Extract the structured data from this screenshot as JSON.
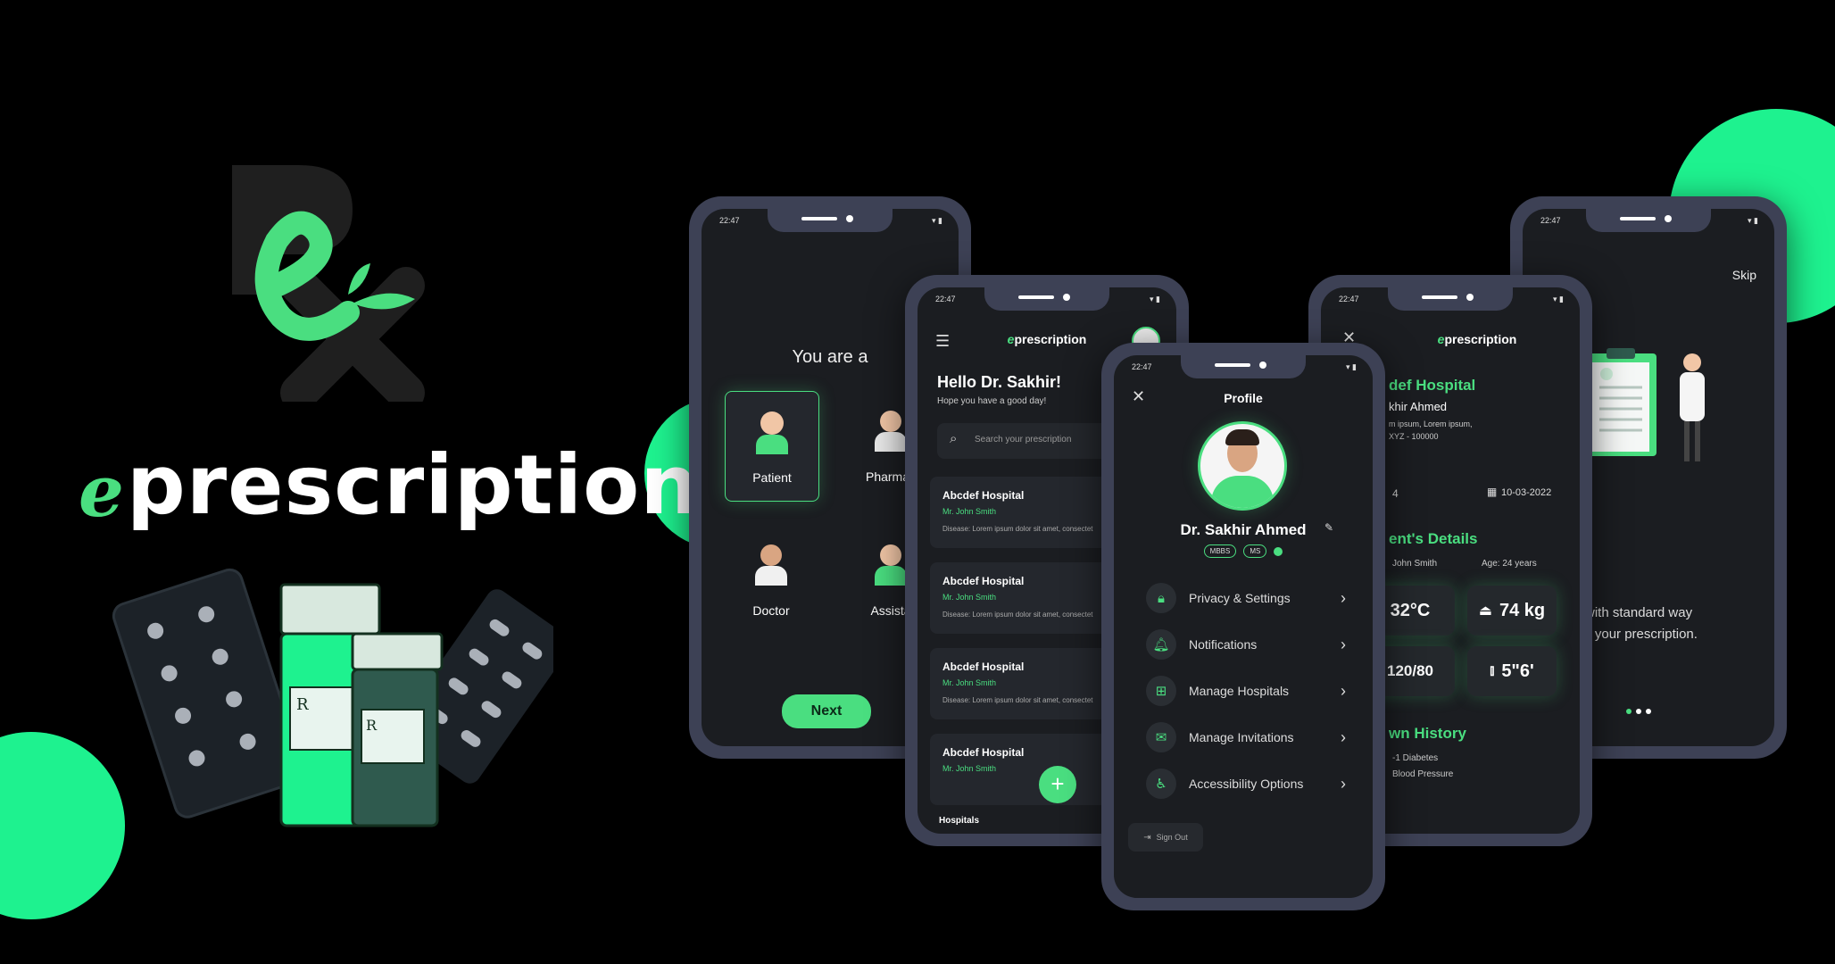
{
  "brand": {
    "prefix": "e",
    "name": "prescription"
  },
  "colors": {
    "accent": "#4ade80",
    "blob": "#1ef28f",
    "phone_frame": "#3d4155",
    "screen_bg": "#1b1d21"
  },
  "status_time": "22:47",
  "role_screen": {
    "heading": "You are a",
    "roles": [
      "Patient",
      "Pharmac",
      "Doctor",
      "Assista"
    ],
    "next_label": "Next"
  },
  "home_screen": {
    "app_title": "prescription",
    "greeting": "Hello Dr. Sakhir!",
    "subgreeting": "Hope you have a good day!",
    "search_placeholder": "Search your prescription",
    "items": [
      {
        "hospital": "Abcdef Hospital",
        "doctor": "Mr. John Smith",
        "detail": "Disease: Lorem ipsum dolor sit amet, consectet"
      },
      {
        "hospital": "Abcdef Hospital",
        "doctor": "Mr. John Smith",
        "detail": "Disease: Lorem ipsum dolor sit amet, consectet"
      },
      {
        "hospital": "Abcdef Hospital",
        "doctor": "Mr. John Smith",
        "detail": "Disease: Lorem ipsum dolor sit amet, consectet"
      },
      {
        "hospital": "Abcdef Hospital",
        "doctor": "Mr. John Smith",
        "detail": ""
      }
    ],
    "bottom_tab": "Hospitals",
    "fab": "+"
  },
  "profile_screen": {
    "title": "Profile",
    "name": "Dr. Sakhir Ahmed",
    "badges": [
      "MBBS",
      "MS"
    ],
    "menu": [
      "Privacy & Settings",
      "Notifications",
      "Manage Hospitals",
      "Manage Invitations",
      "Accessibility Options"
    ],
    "sign_out": "Sign Out"
  },
  "detail_screen": {
    "app_title": "prescription",
    "hospital": "def Hospital",
    "doctor": "khir Ahmed",
    "address": "m ipsum, Lorem ipsum,",
    "postcode": "XYZ - 100000",
    "serial": "4",
    "date": "10-03-2022",
    "section_patient": "ent's Details",
    "patient_name": "John Smith",
    "age": "Age: 24 years",
    "vitals": [
      "32°C",
      "74 kg",
      "120/80",
      "5\"6'"
    ],
    "section_history": "wn History",
    "history": [
      "-1 Diabetes",
      "Blood Pressure"
    ]
  },
  "onboard_screen": {
    "skip": "Skip",
    "line1": "rted with standard way",
    "line2": "aging your prescription."
  }
}
